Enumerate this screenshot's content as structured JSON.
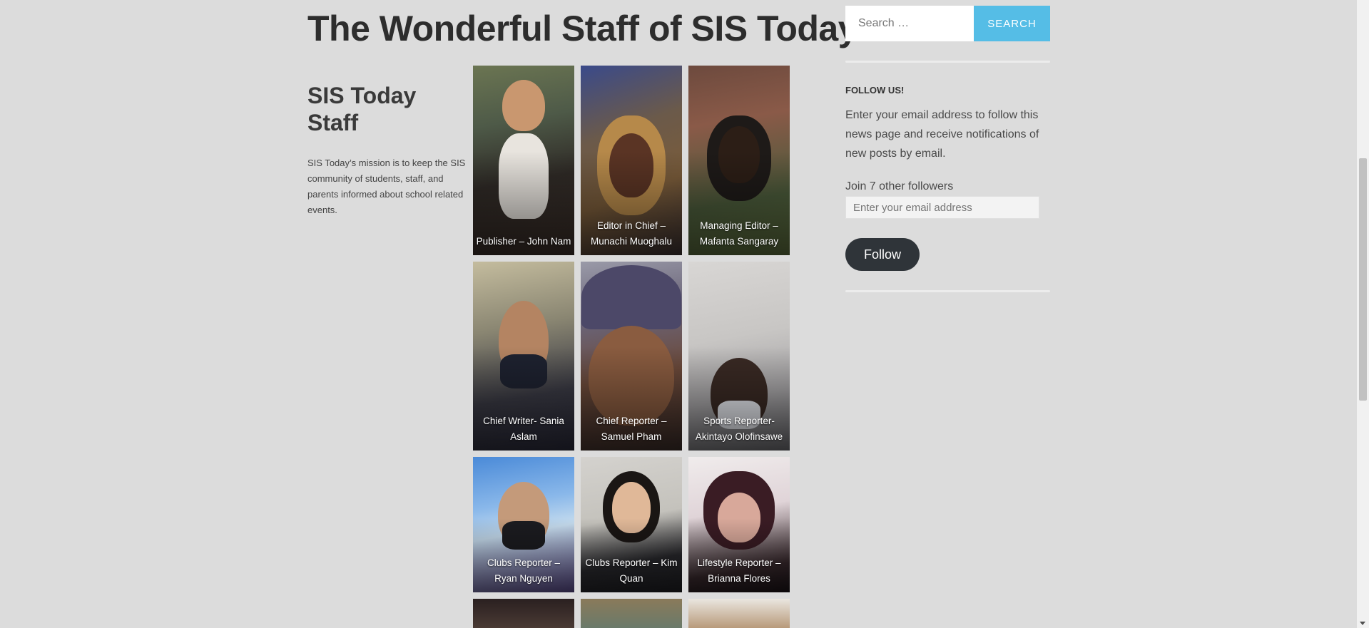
{
  "page": {
    "title": "The Wonderful Staff of SIS Today"
  },
  "intro": {
    "heading": "SIS Today Staff",
    "text": "SIS Today’s mission is to keep the SIS community of students, staff, and parents informed about school related events."
  },
  "staff": [
    {
      "caption": "Publisher – John Nam"
    },
    {
      "caption": "Editor in Chief – Munachi Muoghalu"
    },
    {
      "caption": "Managing Editor – Mafanta Sangaray"
    },
    {
      "caption": "Chief Writer- Sania Aslam"
    },
    {
      "caption": "Chief Reporter – Samuel Pham"
    },
    {
      "caption": "Sports Reporter- Akintayo Olofinsawe"
    },
    {
      "caption": "Clubs Reporter – Ryan Nguyen"
    },
    {
      "caption": "Clubs Reporter – Kim Quan"
    },
    {
      "caption": "Lifestyle Reporter – Brianna Flores"
    }
  ],
  "sidebar": {
    "search": {
      "placeholder": "Search …",
      "button": "Search"
    },
    "follow": {
      "title": "FOLLOW US!",
      "text": "Enter your email address to follow this news page and receive notifications of new posts by email.",
      "followers": "Join 7 other followers",
      "email_placeholder": "Enter your email address",
      "button": "Follow"
    }
  },
  "colors": {
    "accent": "#55bde6",
    "follow_button": "#2f3439",
    "background": "#dcdcdc"
  }
}
